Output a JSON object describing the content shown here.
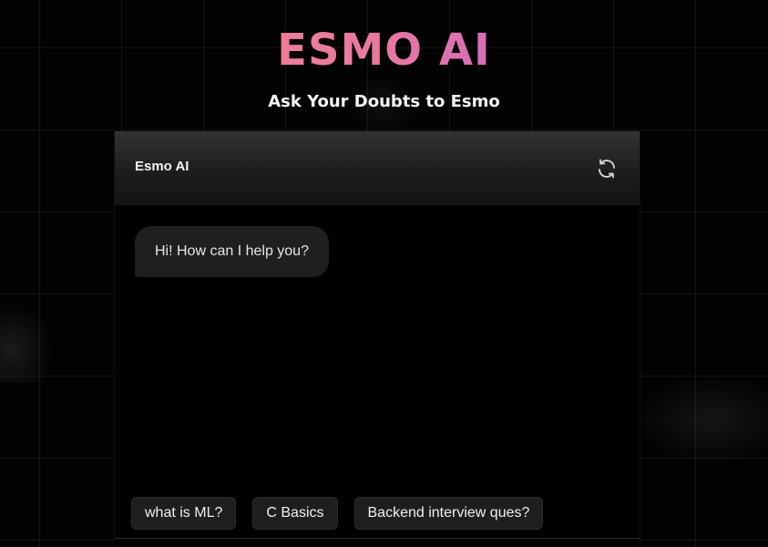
{
  "header": {
    "brand": "ESMO AI",
    "subtitle": "Ask Your Doubts to Esmo"
  },
  "chat": {
    "title": "Esmo AI",
    "refresh_icon": "refresh-icon",
    "messages": [
      {
        "role": "assistant",
        "text": "Hi! How can I help you?"
      }
    ],
    "suggestions": [
      "what is ML?",
      "C Basics",
      "Backend interview ques?"
    ]
  },
  "colors": {
    "brand_gradient_start": "#f98b86",
    "brand_gradient_end": "#a855f7",
    "background": "#000000",
    "bubble": "#1f1f21",
    "chip": "#1e1e20"
  }
}
